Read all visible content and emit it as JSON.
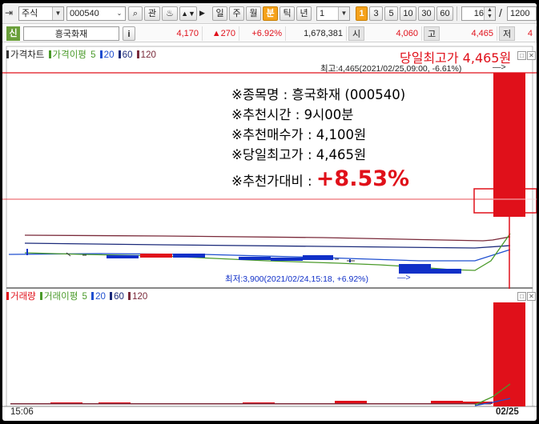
{
  "toolbar": {
    "market_type": "주식",
    "stock_code": "000540",
    "btn_gwan": "관",
    "periods": [
      "일",
      "주",
      "월",
      "분",
      "틱",
      "년"
    ],
    "active_period": "분",
    "interval_value": "1",
    "quick_intervals": [
      "1",
      "3",
      "5",
      "10",
      "30",
      "60"
    ],
    "active_interval": "1",
    "count_value": "16",
    "slash": "/",
    "total_value": "1200"
  },
  "quote": {
    "credit_badge": "신",
    "stock_name": "흥국화재",
    "info_btn": "i",
    "price": "4,170",
    "change": "▲270",
    "change_pct": "+6.92%",
    "volume": "1,678,381",
    "open_label": "시",
    "open_value": "4,060",
    "high_label": "고",
    "high_value": "4,465",
    "low_label": "저",
    "low_value": "4"
  },
  "price_panel": {
    "title": "가격차트",
    "ma_label": "가격이평",
    "ma_periods": [
      "5",
      "20",
      "60",
      "120"
    ],
    "ma_colors": [
      "#4a9a2a",
      "#1f4fd0",
      "#1b2a7a",
      "#7a2a3a"
    ],
    "high_marker": "최고:4,465(2021/02/25,09:00, -6.61%)",
    "low_marker": "최저:3,900(2021/02/24,15:18, +6.92%)",
    "day_high_caption": "당일최고가 4,465원"
  },
  "annotation": {
    "line1": "※종목명 : 흥국화재 (000540)",
    "line2": "※추천시간 : 9시00분",
    "line3": "※추천매수가 : 4,100원",
    "line4": "※당일최고가 : 4,465원",
    "line5_label": "※추천가대비 : ",
    "line5_value": "+8.53%"
  },
  "volume_panel": {
    "title": "거래량",
    "ma_label": "거래이평",
    "ma_periods": [
      "5",
      "20",
      "60",
      "120"
    ]
  },
  "xaxis": {
    "left_label": "15:06",
    "right_label": "02/25"
  },
  "colors": {
    "up": "#e0101a",
    "down": "#1030c8",
    "accent": "#f5a21a"
  }
}
